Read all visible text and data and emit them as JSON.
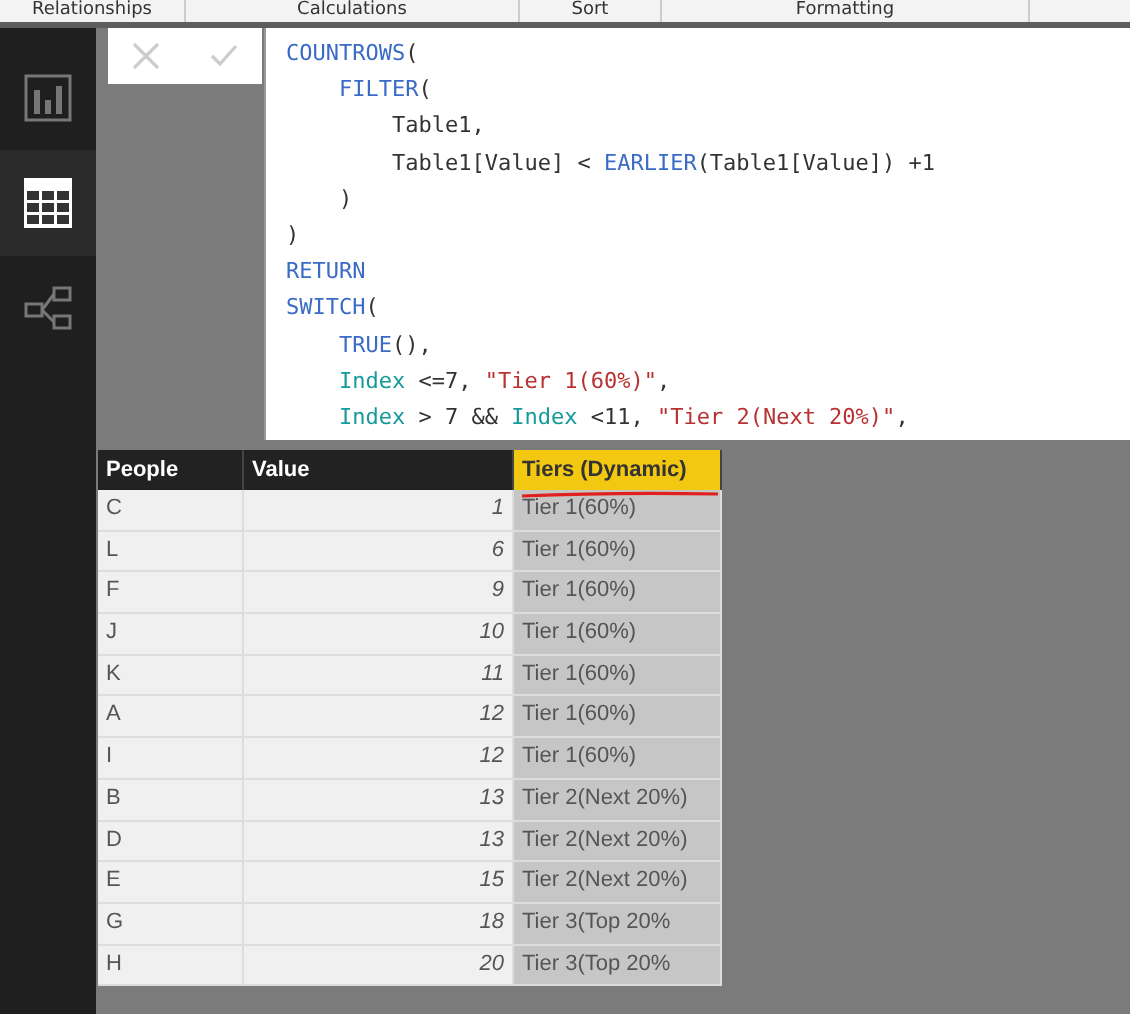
{
  "ribbon": {
    "groups": [
      "Relationships",
      "Calculations",
      "Sort",
      "Formatting"
    ]
  },
  "sidebar": {
    "items": [
      {
        "kind": "report",
        "selected": false
      },
      {
        "kind": "data",
        "selected": true
      },
      {
        "kind": "model",
        "selected": false
      }
    ]
  },
  "formula_bar": {
    "code": [
      [
        {
          "kind": "keyword",
          "text": "COUNTROWS"
        },
        {
          "kind": "plain",
          "text": "("
        }
      ],
      [
        {
          "kind": "keyword",
          "text": "    FILTER"
        },
        {
          "kind": "plain",
          "text": "("
        }
      ],
      [
        {
          "kind": "plain",
          "text": "        Table1,"
        }
      ],
      [
        {
          "kind": "plain",
          "text": "        Table1[Value] < "
        },
        {
          "kind": "keyword",
          "text": "EARLIER"
        },
        {
          "kind": "plain",
          "text": "(Table1[Value]) +1"
        }
      ],
      [
        {
          "kind": "plain",
          "text": "    )"
        }
      ],
      [
        {
          "kind": "plain",
          "text": ")"
        }
      ],
      [
        {
          "kind": "keyword",
          "text": "RETURN"
        }
      ],
      [
        {
          "kind": "keyword",
          "text": "SWITCH"
        },
        {
          "kind": "plain",
          "text": "("
        }
      ],
      [
        {
          "kind": "keyword",
          "text": "    TRUE"
        },
        {
          "kind": "plain",
          "text": "(),"
        }
      ],
      [
        {
          "kind": "variable",
          "text": "    Index"
        },
        {
          "kind": "plain",
          "text": " <=7, "
        },
        {
          "kind": "string",
          "text": "\"Tier 1(60%)\""
        },
        {
          "kind": "plain",
          "text": ","
        }
      ],
      [
        {
          "kind": "variable",
          "text": "    Index"
        },
        {
          "kind": "plain",
          "text": " > 7 && "
        },
        {
          "kind": "variable",
          "text": "Index"
        },
        {
          "kind": "plain",
          "text": " <11, "
        },
        {
          "kind": "string",
          "text": "\"Tier 2(Next 20%)\""
        },
        {
          "kind": "plain",
          "text": ","
        }
      ]
    ]
  },
  "table": {
    "columns": [
      {
        "label": "People",
        "selected": false
      },
      {
        "label": "Value",
        "selected": false
      },
      {
        "label": "Tiers (Dynamic)",
        "selected": true
      }
    ],
    "rows": [
      [
        "C",
        "1",
        "Tier 1(60%)"
      ],
      [
        "L",
        "6",
        "Tier 1(60%)"
      ],
      [
        "F",
        "9",
        "Tier 1(60%)"
      ],
      [
        "J",
        "10",
        "Tier 1(60%)"
      ],
      [
        "K",
        "11",
        "Tier 1(60%)"
      ],
      [
        "A",
        "12",
        "Tier 1(60%)"
      ],
      [
        "I",
        "12",
        "Tier 1(60%)"
      ],
      [
        "B",
        "13",
        "Tier 2(Next 20%)"
      ],
      [
        "D",
        "13",
        "Tier 2(Next 20%)"
      ],
      [
        "E",
        "15",
        "Tier 2(Next 20%)"
      ],
      [
        "G",
        "18",
        "Tier 3(Top 20%"
      ],
      [
        "H",
        "20",
        "Tier 3(Top 20%"
      ]
    ]
  }
}
